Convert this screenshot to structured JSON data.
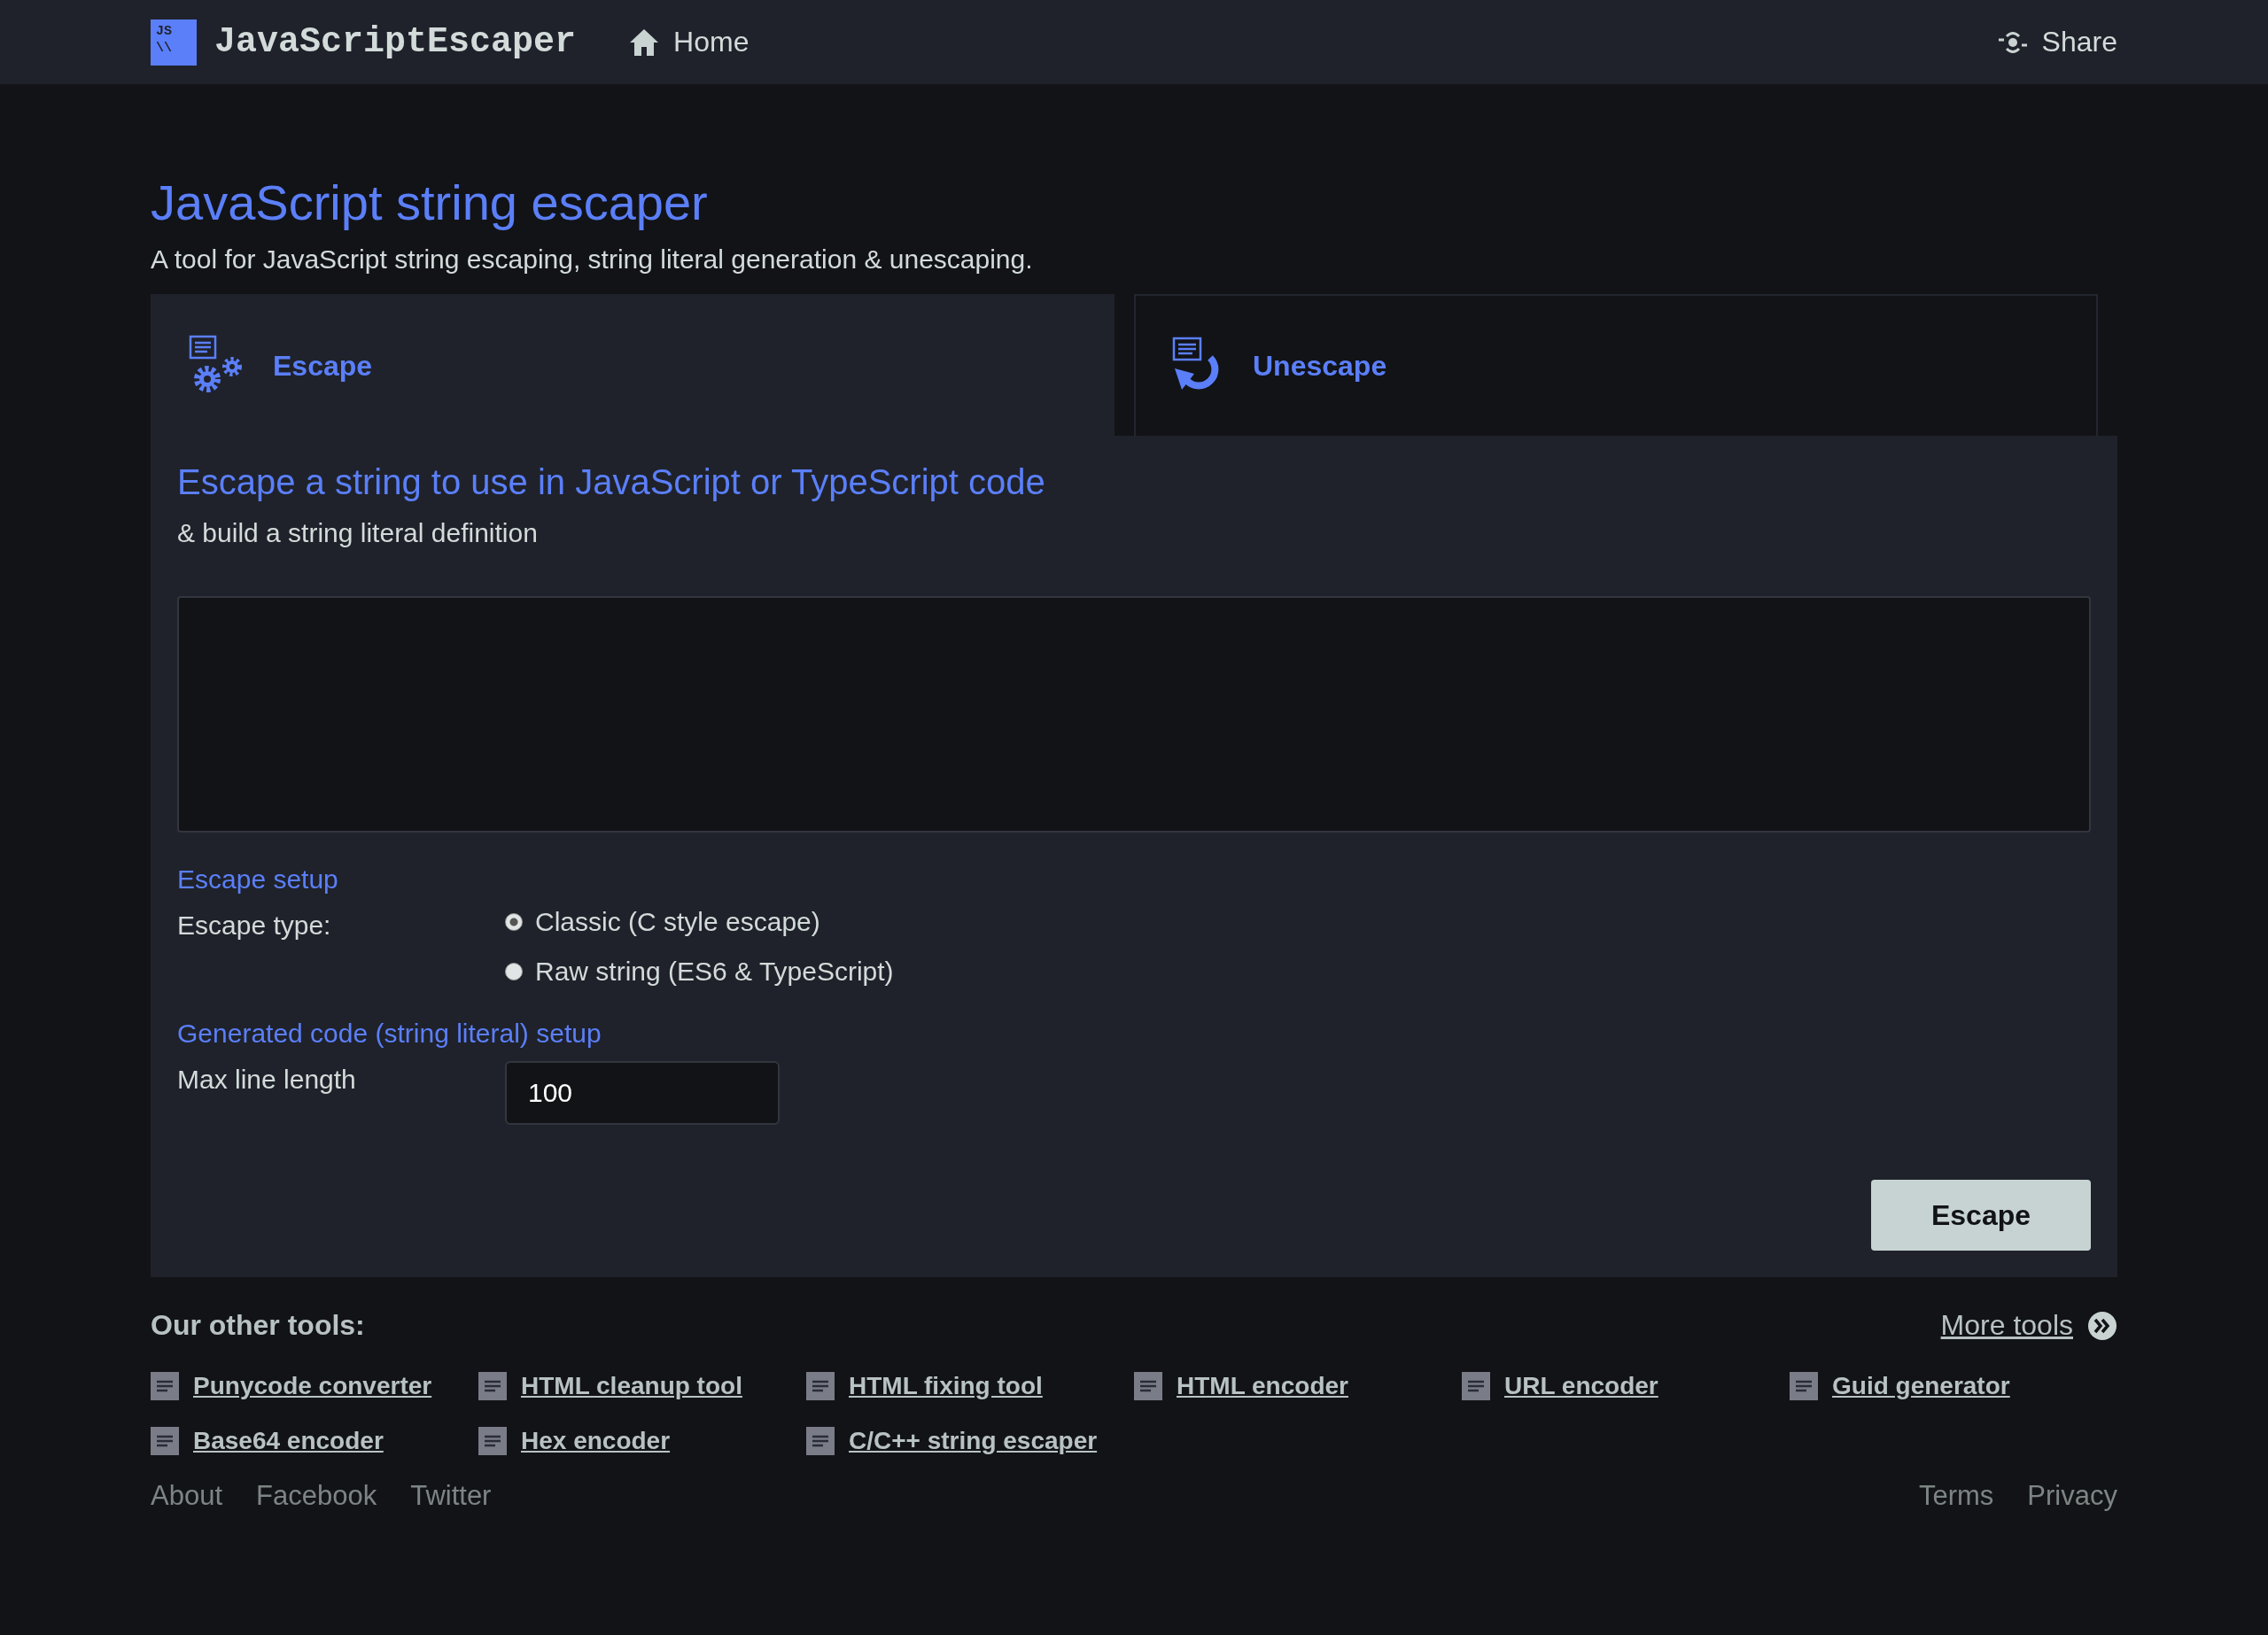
{
  "header": {
    "logo_mark": [
      "JS",
      "\\\\"
    ],
    "brand": "JavaScriptEscaper",
    "nav": [
      {
        "label": "Home"
      }
    ],
    "share": "Share"
  },
  "page": {
    "title": "JavaScript string escaper",
    "subtitle": "A tool for JavaScript string escaping, string literal generation & unescaping."
  },
  "tabs": [
    {
      "label": "Escape",
      "kind": "escape",
      "selected": true
    },
    {
      "label": "Unescape",
      "kind": "unescape",
      "selected": false
    }
  ],
  "panel": {
    "heading": "Escape a string to use in JavaScript or TypeScript code",
    "subheading": "& build a string literal definition",
    "escape_setup": {
      "title": "Escape setup",
      "label": "Escape type:",
      "options": [
        {
          "label": "Classic (C style escape)",
          "selected": true
        },
        {
          "label": "Raw string (ES6 & TypeScript)",
          "selected": false
        }
      ]
    },
    "code_setup": {
      "title": "Generated code (string literal) setup",
      "label": "Max line length",
      "value": "100"
    },
    "button": "Escape"
  },
  "other_tools": {
    "title": "Our other tools:",
    "more": "More tools",
    "items": [
      {
        "label": "Punycode converter"
      },
      {
        "label": "HTML cleanup tool"
      },
      {
        "label": "HTML fixing tool"
      },
      {
        "label": "HTML encoder"
      },
      {
        "label": "URL encoder"
      },
      {
        "label": "Guid generator"
      },
      {
        "label": "Base64 encoder"
      },
      {
        "label": "Hex encoder"
      },
      {
        "label": "C/C++ string escaper"
      }
    ]
  },
  "footer": {
    "left": [
      "About",
      "Facebook",
      "Twitter"
    ],
    "right": [
      "Terms",
      "Privacy"
    ]
  }
}
